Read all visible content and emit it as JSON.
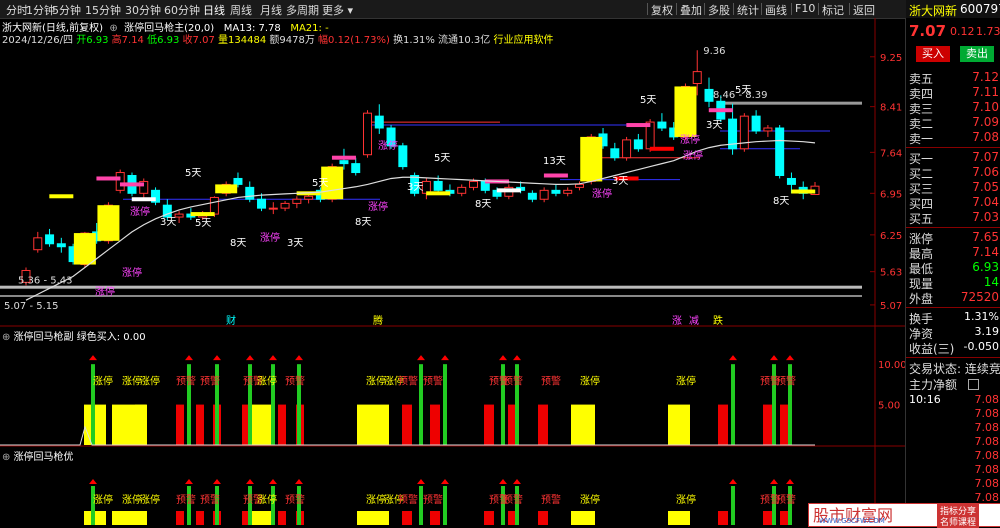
{
  "topbar": {
    "left_items": [
      "分时",
      "1分钟",
      "5分钟",
      "15分钟",
      "30分钟",
      "60分钟",
      "日线",
      "周线",
      "月线",
      "多周期",
      "更多"
    ],
    "active_item": "日线",
    "right_items": [
      "复权",
      "叠加",
      "多股",
      "统计",
      "画线",
      "F10",
      "标记",
      "返回"
    ]
  },
  "header": {
    "line1_title": "浙大网新(日线,前复权)",
    "line1_indicator": "涨停回马枪主(20,0)",
    "line1_ma13": "MA13: 7.78",
    "line1_ma21": "MA21: -",
    "line2": {
      "date": "2024/12/26/四",
      "open": "开6.93",
      "high": "高7.14",
      "low": "低6.93",
      "close": "收7.07",
      "volume": "量134484",
      "amount": "额9478万",
      "change": "幅0.12(1.73%)",
      "turnover": "换1.31%",
      "float": "流通10.3亿",
      "industry": "行业应用软件"
    }
  },
  "main_chart": {
    "price_axis": [
      "9.25",
      "8.41",
      "7.64",
      "6.95",
      "6.25",
      "5.63",
      "5.07"
    ],
    "annotations": {
      "top_high": "9.36",
      "range_high": "8.46 - 8.39",
      "range_low": "5.36 - 5.43",
      "bottom_low": "5.07 - 5.15",
      "days_labels": [
        "5天",
        "5天",
        "5天",
        "5天",
        "5天",
        "13天",
        "5天",
        "3天",
        "8天",
        "3天",
        "8天",
        "3天",
        "8天",
        "3天",
        "3天",
        "8天"
      ],
      "zt_labels": [
        "涨停",
        "涨停",
        "涨停",
        "涨停",
        "涨停",
        "涨停",
        "涨停",
        "涨停",
        "涨停"
      ],
      "events": [
        "财",
        "腾",
        "涨",
        "减",
        "跌"
      ]
    },
    "candles": [
      {
        "o": 5.45,
        "h": 5.7,
        "l": 5.4,
        "c": 5.65
      },
      {
        "o": 6.0,
        "h": 6.3,
        "l": 5.95,
        "c": 6.2
      },
      {
        "o": 6.25,
        "h": 6.35,
        "l": 6.05,
        "c": 6.1
      },
      {
        "o": 6.1,
        "h": 6.2,
        "l": 5.95,
        "c": 6.05
      },
      {
        "o": 6.05,
        "h": 6.1,
        "l": 5.75,
        "c": 5.8
      },
      {
        "o": 5.75,
        "h": 6.3,
        "l": 5.7,
        "c": 6.28
      },
      {
        "o": 6.3,
        "h": 6.45,
        "l": 6.1,
        "c": 6.15
      },
      {
        "o": 6.15,
        "h": 6.8,
        "l": 6.1,
        "c": 6.75
      },
      {
        "o": 7.0,
        "h": 7.35,
        "l": 6.95,
        "c": 7.3
      },
      {
        "o": 7.25,
        "h": 7.3,
        "l": 6.9,
        "c": 6.95
      },
      {
        "o": 6.95,
        "h": 7.2,
        "l": 6.85,
        "c": 7.15
      },
      {
        "o": 7.0,
        "h": 7.05,
        "l": 6.75,
        "c": 6.8
      },
      {
        "o": 6.75,
        "h": 6.85,
        "l": 6.5,
        "c": 6.55
      },
      {
        "o": 6.55,
        "h": 6.65,
        "l": 6.45,
        "c": 6.6
      },
      {
        "o": 6.6,
        "h": 6.7,
        "l": 6.5,
        "c": 6.55
      },
      {
        "o": 6.55,
        "h": 6.65,
        "l": 6.5,
        "c": 6.6
      },
      {
        "o": 6.6,
        "h": 6.9,
        "l": 6.55,
        "c": 6.88
      },
      {
        "o": 6.95,
        "h": 7.15,
        "l": 6.9,
        "c": 7.1
      },
      {
        "o": 7.2,
        "h": 7.3,
        "l": 7.05,
        "c": 7.1
      },
      {
        "o": 7.05,
        "h": 7.15,
        "l": 6.8,
        "c": 6.85
      },
      {
        "o": 6.85,
        "h": 6.95,
        "l": 6.65,
        "c": 6.7
      },
      {
        "o": 6.7,
        "h": 6.8,
        "l": 6.6,
        "c": 6.7
      },
      {
        "o": 6.7,
        "h": 6.82,
        "l": 6.65,
        "c": 6.78
      },
      {
        "o": 6.78,
        "h": 6.9,
        "l": 6.7,
        "c": 6.85
      },
      {
        "o": 6.85,
        "h": 6.95,
        "l": 6.78,
        "c": 6.9
      },
      {
        "o": 7.0,
        "h": 7.05,
        "l": 6.8,
        "c": 6.85
      },
      {
        "o": 6.85,
        "h": 7.45,
        "l": 6.8,
        "c": 7.4
      },
      {
        "o": 7.5,
        "h": 7.7,
        "l": 7.35,
        "c": 7.45
      },
      {
        "o": 7.45,
        "h": 7.55,
        "l": 7.25,
        "c": 7.3
      },
      {
        "o": 7.6,
        "h": 8.35,
        "l": 7.55,
        "c": 8.3
      },
      {
        "o": 8.25,
        "h": 8.45,
        "l": 7.95,
        "c": 8.05
      },
      {
        "o": 8.05,
        "h": 8.1,
        "l": 7.7,
        "c": 7.75
      },
      {
        "o": 7.75,
        "h": 7.8,
        "l": 7.35,
        "c": 7.4
      },
      {
        "o": 7.25,
        "h": 7.3,
        "l": 6.9,
        "c": 6.95
      },
      {
        "o": 6.95,
        "h": 7.2,
        "l": 6.85,
        "c": 7.15
      },
      {
        "o": 7.15,
        "h": 7.25,
        "l": 6.95,
        "c": 7.0
      },
      {
        "o": 7.0,
        "h": 7.1,
        "l": 6.9,
        "c": 6.95
      },
      {
        "o": 6.95,
        "h": 7.1,
        "l": 6.9,
        "c": 7.05
      },
      {
        "o": 7.05,
        "h": 7.2,
        "l": 7.0,
        "c": 7.15
      },
      {
        "o": 7.15,
        "h": 7.2,
        "l": 6.95,
        "c": 7.0
      },
      {
        "o": 7.0,
        "h": 7.05,
        "l": 6.85,
        "c": 6.9
      },
      {
        "o": 6.9,
        "h": 7.1,
        "l": 6.85,
        "c": 7.05
      },
      {
        "o": 7.05,
        "h": 7.15,
        "l": 6.95,
        "c": 7.0
      },
      {
        "o": 6.95,
        "h": 7.0,
        "l": 6.8,
        "c": 6.85
      },
      {
        "o": 6.85,
        "h": 7.05,
        "l": 6.8,
        "c": 7.0
      },
      {
        "o": 7.0,
        "h": 7.1,
        "l": 6.9,
        "c": 6.95
      },
      {
        "o": 6.95,
        "h": 7.05,
        "l": 6.9,
        "c": 7.0
      },
      {
        "o": 7.05,
        "h": 7.15,
        "l": 7.0,
        "c": 7.1
      },
      {
        "o": 7.15,
        "h": 7.95,
        "l": 7.1,
        "c": 7.9
      },
      {
        "o": 7.95,
        "h": 8.05,
        "l": 7.7,
        "c": 7.75
      },
      {
        "o": 7.7,
        "h": 7.8,
        "l": 7.5,
        "c": 7.55
      },
      {
        "o": 7.55,
        "h": 7.9,
        "l": 7.5,
        "c": 7.85
      },
      {
        "o": 7.85,
        "h": 7.95,
        "l": 7.65,
        "c": 7.7
      },
      {
        "o": 7.7,
        "h": 8.2,
        "l": 7.65,
        "c": 8.15
      },
      {
        "o": 8.15,
        "h": 8.3,
        "l": 8.0,
        "c": 8.05
      },
      {
        "o": 8.05,
        "h": 8.15,
        "l": 7.85,
        "c": 7.9
      },
      {
        "o": 7.9,
        "h": 8.8,
        "l": 7.85,
        "c": 8.75
      },
      {
        "o": 8.8,
        "h": 9.36,
        "l": 8.6,
        "c": 9.0
      },
      {
        "o": 8.7,
        "h": 8.9,
        "l": 8.4,
        "c": 8.5
      },
      {
        "o": 8.5,
        "h": 8.6,
        "l": 8.15,
        "c": 8.2
      },
      {
        "o": 8.2,
        "h": 8.46,
        "l": 7.6,
        "c": 7.7
      },
      {
        "o": 7.7,
        "h": 8.3,
        "l": 7.65,
        "c": 8.25
      },
      {
        "o": 8.25,
        "h": 8.35,
        "l": 7.95,
        "c": 8.0
      },
      {
        "o": 8.0,
        "h": 8.1,
        "l": 7.9,
        "c": 8.05
      },
      {
        "o": 8.05,
        "h": 8.1,
        "l": 7.2,
        "c": 7.25
      },
      {
        "o": 7.2,
        "h": 7.3,
        "l": 6.95,
        "c": 7.1
      },
      {
        "o": 7.05,
        "h": 7.15,
        "l": 6.85,
        "c": 6.95
      },
      {
        "o": 6.93,
        "h": 7.14,
        "l": 6.93,
        "c": 7.07
      }
    ],
    "ma": [
      5.15,
      5.25,
      5.35,
      5.45,
      5.55,
      5.7,
      5.85,
      6.0,
      6.15,
      6.3,
      6.42,
      6.52,
      6.6,
      6.67,
      6.72,
      6.76,
      6.8,
      6.84,
      6.88,
      6.9,
      6.92,
      6.93,
      6.94,
      6.95,
      6.96,
      6.97,
      7.0,
      7.03,
      7.06,
      7.1,
      7.15,
      7.2,
      7.22,
      7.22,
      7.21,
      7.2,
      7.19,
      7.18,
      7.17,
      7.16,
      7.15,
      7.14,
      7.13,
      7.12,
      7.11,
      7.1,
      7.1,
      7.11,
      7.15,
      7.2,
      7.25,
      7.3,
      7.35,
      7.4,
      7.45,
      7.5,
      7.58,
      7.66,
      7.72,
      7.76,
      7.78,
      7.8,
      7.82,
      7.83,
      7.84,
      7.83,
      7.82,
      7.8
    ]
  },
  "sub_panel_1": {
    "title": "涨停回马枪副",
    "subtitle": "绿色买入: 0.00",
    "axis": [
      "10.00",
      "5.00"
    ],
    "labels": [
      "涨停",
      "涨停",
      "涨停",
      "预警",
      "预警",
      "预警",
      "涨停",
      "预警",
      "涨停",
      "涨停",
      "预警",
      "预警",
      "预警",
      "预警",
      "预警",
      "涨停",
      "涨停",
      "预警",
      "预警"
    ]
  },
  "sub_panel_2": {
    "title": "涨停回马枪优",
    "labels": [
      "涨停",
      "涨停",
      "涨停",
      "预警",
      "预警",
      "预警",
      "涨停",
      "预警",
      "涨停",
      "涨停",
      "预警",
      "预警",
      "预警",
      "预警",
      "预警",
      "涨停",
      "涨停",
      "预警",
      "预警"
    ]
  },
  "right_panel": {
    "stock_name": "浙大网新",
    "stock_code": "600797",
    "price": "7.07",
    "change": "0.12",
    "change_pct": "1.73%",
    "buy_label": "买入",
    "sell_label": "卖出",
    "asks": [
      {
        "label": "卖五",
        "price": "7.12"
      },
      {
        "label": "卖四",
        "price": "7.11"
      },
      {
        "label": "卖三",
        "price": "7.10"
      },
      {
        "label": "卖二",
        "price": "7.09"
      },
      {
        "label": "卖一",
        "price": "7.08"
      }
    ],
    "bids": [
      {
        "label": "买一",
        "price": "7.07"
      },
      {
        "label": "买二",
        "price": "7.06"
      },
      {
        "label": "买三",
        "price": "7.05"
      },
      {
        "label": "买四",
        "price": "7.04"
      },
      {
        "label": "买五",
        "price": "7.03"
      }
    ],
    "stats": [
      {
        "label": "涨停",
        "value": "7.65"
      },
      {
        "label": "最高",
        "value": "7.14"
      },
      {
        "label": "最低",
        "value": "6.93"
      },
      {
        "label": "现量",
        "value": "14"
      },
      {
        "label": "外盘",
        "value": "72520"
      }
    ],
    "stats2": [
      {
        "label": "换手",
        "value": "1.31%"
      },
      {
        "label": "净资",
        "value": "3.19"
      },
      {
        "label": "收益(三)",
        "value": "-0.050"
      }
    ],
    "trade_status": "交易状态: 连续竞",
    "main_net": "主力净额",
    "ticks": [
      {
        "time": "10:16",
        "price": "7.08"
      },
      {
        "time": "",
        "price": "7.08"
      },
      {
        "time": "",
        "price": "7.08"
      },
      {
        "time": "",
        "price": "7.08"
      },
      {
        "time": "",
        "price": "7.08"
      },
      {
        "time": "",
        "price": "7.08"
      },
      {
        "time": "",
        "price": "7.08"
      },
      {
        "time": "",
        "price": "7.08"
      }
    ]
  },
  "watermark": {
    "name": "股市财富网",
    "url": "WWW.GSCFW.COM",
    "tag1": "指标分享",
    "tag2": "名师课程"
  }
}
